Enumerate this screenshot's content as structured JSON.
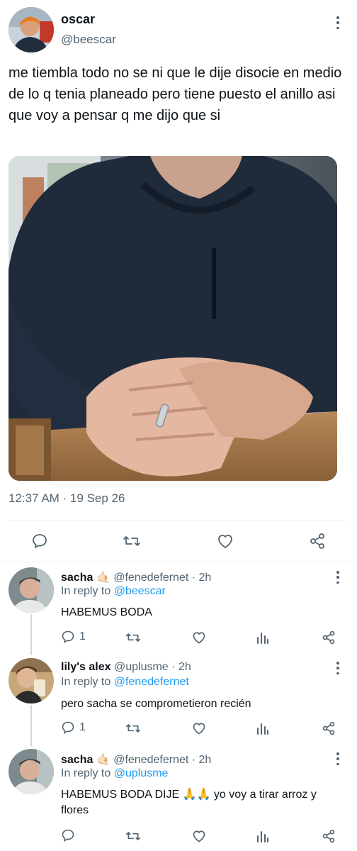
{
  "tweet": {
    "author_name": "oscar",
    "author_handle": "@beescar",
    "text": "me tiembla todo no se ni que le dije disocie en medio de lo q tenia planeado pero tiene puesto el anillo asi que voy a pensar q me dijo que si",
    "timestamp": "12:37 AM · 19 Sep 26"
  },
  "replies": [
    {
      "author_name": "sacha",
      "emoji": "🤙🏻",
      "handle": "@fenedefernet",
      "age": "· 2h",
      "in_reply_prefix": "In reply to",
      "in_reply_handle": "@beescar",
      "text": "HABEMUS BODA",
      "reply_count": "1"
    },
    {
      "author_name": "lily's alex",
      "handle": "@uplusme",
      "age": "· 2h",
      "in_reply_prefix": "In reply to",
      "in_reply_handle": "@fenedefernet",
      "text": "pero sacha se comprometieron recién",
      "reply_count": "1"
    },
    {
      "author_name": "sacha",
      "emoji": "🤙🏻",
      "handle": "@fenedefernet",
      "age": "· 2h",
      "in_reply_prefix": "In reply to",
      "in_reply_handle": "@uplusme",
      "text": "HABEMUS BODA DIJE 🙏🙏 yo voy a tirar arroz y flores",
      "reply_count": ""
    }
  ],
  "colors": {
    "accent": "#1d9bf0",
    "muted": "#536471",
    "text": "#0f1419"
  }
}
